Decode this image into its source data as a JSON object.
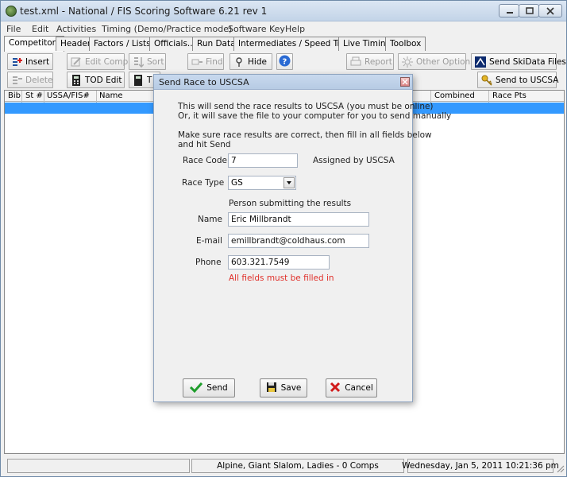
{
  "window": {
    "title": "test.xml - National / FIS Scoring Software 6.21 rev 1"
  },
  "menu": {
    "items": [
      "File",
      "Edit",
      "Activities",
      "Timing (Demo/Practice mode)",
      "Software Key",
      "Help"
    ]
  },
  "tabs": {
    "items": [
      "Competitors",
      "Header",
      "Factors / Lists...",
      "Officials...",
      "Run Data",
      "Intermediates / Speed Traps",
      "Live Timing",
      "Toolbox"
    ]
  },
  "toolbar1": {
    "insert": "Insert",
    "edit_comp": "Edit Comp",
    "sort": "Sort",
    "find": "Find",
    "hide": "Hide",
    "report": "Report",
    "other_options": "Other Options",
    "send_skidata": "Send SkiData Files"
  },
  "toolbar2": {
    "delete": "Delete",
    "tod_edit": "TOD Edit",
    "tod2": "T",
    "send_uscsa": "Send to USCSA"
  },
  "grid": {
    "columns": [
      "Bib",
      "St #",
      "USSA/FIS#",
      "Name",
      "Combined",
      "Race Pts"
    ]
  },
  "status": {
    "event": "Alpine, Giant Slalom, Ladies - 0 Comps",
    "datetime": "Wednesday, Jan 5, 2011  10:21:36 pm"
  },
  "dialog": {
    "title": "Send Race to USCSA",
    "intro_line1": "This will send the race results to USCSA (you must be online)",
    "intro_line2": "Or, it will save the file to your computer for you to send manually",
    "instruct_line1": "Make sure race results are correct, then fill in all fields below",
    "instruct_line2": "and hit Send",
    "race_code_label": "Race Code",
    "race_code_value": "7",
    "assigned_note": "Assigned by USCSA",
    "race_type_label": "Race Type",
    "race_type_value": "GS",
    "person_heading": "Person submitting the results",
    "name_label": "Name",
    "name_value": "Eric Millbrandt",
    "email_label": "E-mail",
    "email_value": "emillbrandt@coldhaus.com",
    "phone_label": "Phone",
    "phone_value": "603.321.7549",
    "warning": "All fields must be filled in",
    "send_label": "Send",
    "save_label": "Save",
    "cancel_label": "Cancel"
  },
  "colors": {
    "selection": "#3399ff",
    "warning": "#e0302a",
    "send_check": "#1f9e2c",
    "cancel_x": "#d11b1b"
  }
}
